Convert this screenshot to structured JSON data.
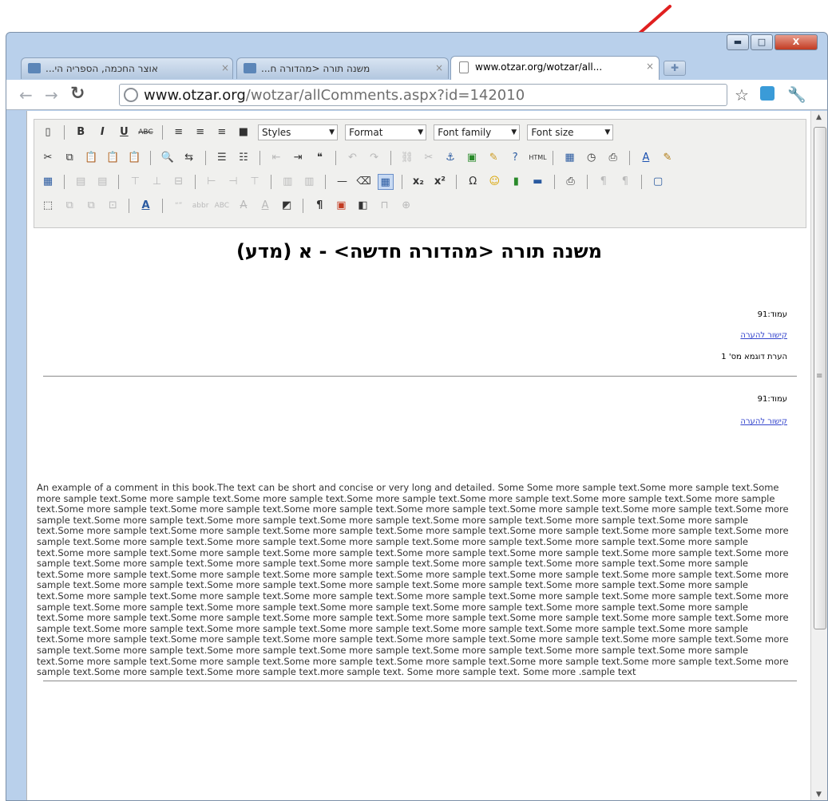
{
  "window": {
    "minimize_label": "▬",
    "maximize_label": "□",
    "close_label": "X"
  },
  "tabs": [
    {
      "title": "...אוצר החכמה, הספריה הי",
      "close": "×"
    },
    {
      "title": "...משנה תורה <מהדורה ח",
      "close": "×"
    },
    {
      "title": "www.otzar.org/wotzar/all...",
      "close": "×"
    }
  ],
  "new_tab_label": "✚",
  "address_bar": {
    "host": "www.otzar.org",
    "path": "/wotzar/allComments.aspx?id=142010"
  },
  "editor_toolbar": {
    "styles_label": "Styles",
    "format_label": "Format",
    "font_family_label": "Font family",
    "font_size_label": "Font size"
  },
  "document": {
    "title": "משנה תורה <מהדורה חדשה> - א (מדע)",
    "comments": [
      {
        "page_label": "עמוד:91",
        "link_text": "קישור להערה",
        "text": "הערת דוגמא מס' 1"
      },
      {
        "page_label": "עמוד:91",
        "link_text": "קישור להערה",
        "text": "An example of  a comment in this book.The text can be short and concise or very long and detailed. Some  Some more sample text.Some more sample text.Some more sample text.Some more sample text.Some more sample text.Some more sample text.Some more sample text.Some more sample text.Some more sample text.Some more sample text.Some more sample text.Some more sample text.Some more sample text.Some more sample text.Some more sample text.Some more sample text.Some more sample text.Some more sample text.Some more sample text.Some more sample text.Some more sample text.Some more sample text.Some more sample text.Some more sample text.Some more sample text.Some more sample text.Some more sample text.Some more sample text.Some more sample text.Some more sample text.Some more sample text.Some more sample text.Some more sample text.Some more sample text.Some more sample text.Some more sample text.Some more sample text.Some more sample text.Some more sample text.Some more sample text.Some more sample text.Some more sample text.Some more sample text.Some more sample text.Some more sample text.Some more sample text.Some more sample text.Some more sample text.Some more sample text.Some more sample text.Some more sample text.Some more sample text.Some more sample text.Some more sample text.Some more sample text.Some more sample text.Some more sample text.Some more sample text.Some more sample text.Some more sample text.Some more sample text.Some more sample text.Some more sample text.Some more sample text.Some more sample text.Some more sample text.Some more sample text.Some more sample text.Some more sample text.Some more sample text.Some more sample text.Some more sample text.Some more sample text.Some more sample text.Some more sample text.Some more sample text.Some more sample text.Some more sample text.Some more sample text.Some more sample text.Some more sample text.Some more sample text.Some more sample text.Some more sample text.Some more sample text.Some more sample text.Some more sample text.Some more sample text.Some more sample text.Some more sample text.Some more sample text.Some more sample text.Some more sample text.Some more sample text.Some more sample text.Some more sample text.Some more sample text.Some more sample text.Some more sample text.Some more sample text.Some more sample text.Some more sample text.Some more sample text.Some more sample text.Some more sample text.Some more sample text.Some more sample text.Some more sample text.Some more sample text.more sample text. Some more sample text. Some more .sample text"
      }
    ]
  }
}
